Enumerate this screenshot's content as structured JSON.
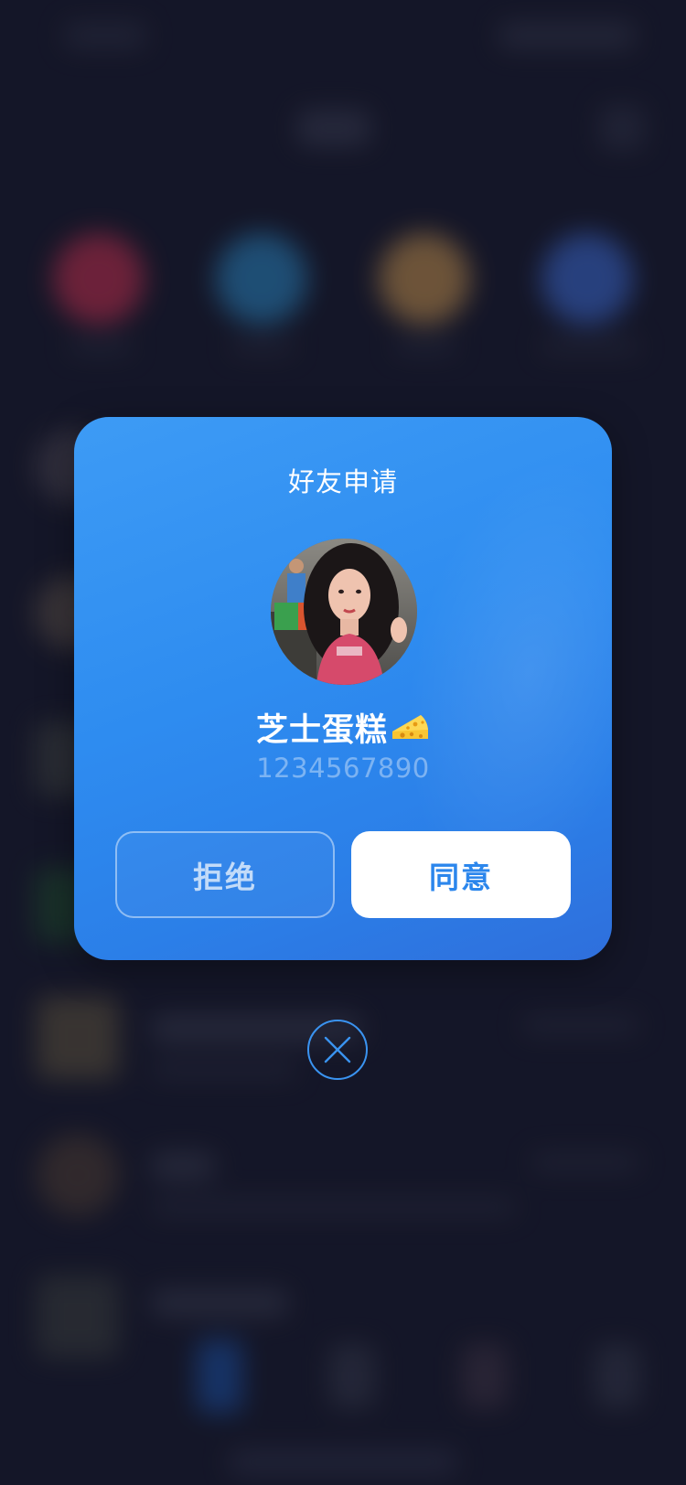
{
  "dialog": {
    "title": "好友申请",
    "user": {
      "name": "芝士蛋糕",
      "id": "1234567890"
    },
    "reject_label": "拒绝",
    "accept_label": "同意"
  },
  "icons": {
    "name_emoji": "cheese-icon",
    "close": "close-icon"
  },
  "colors": {
    "dialog_bg": "#2e8cf0",
    "accept_text": "#2b86ec",
    "background": "#1a1b2e",
    "close_ring": "#3a93f0"
  }
}
